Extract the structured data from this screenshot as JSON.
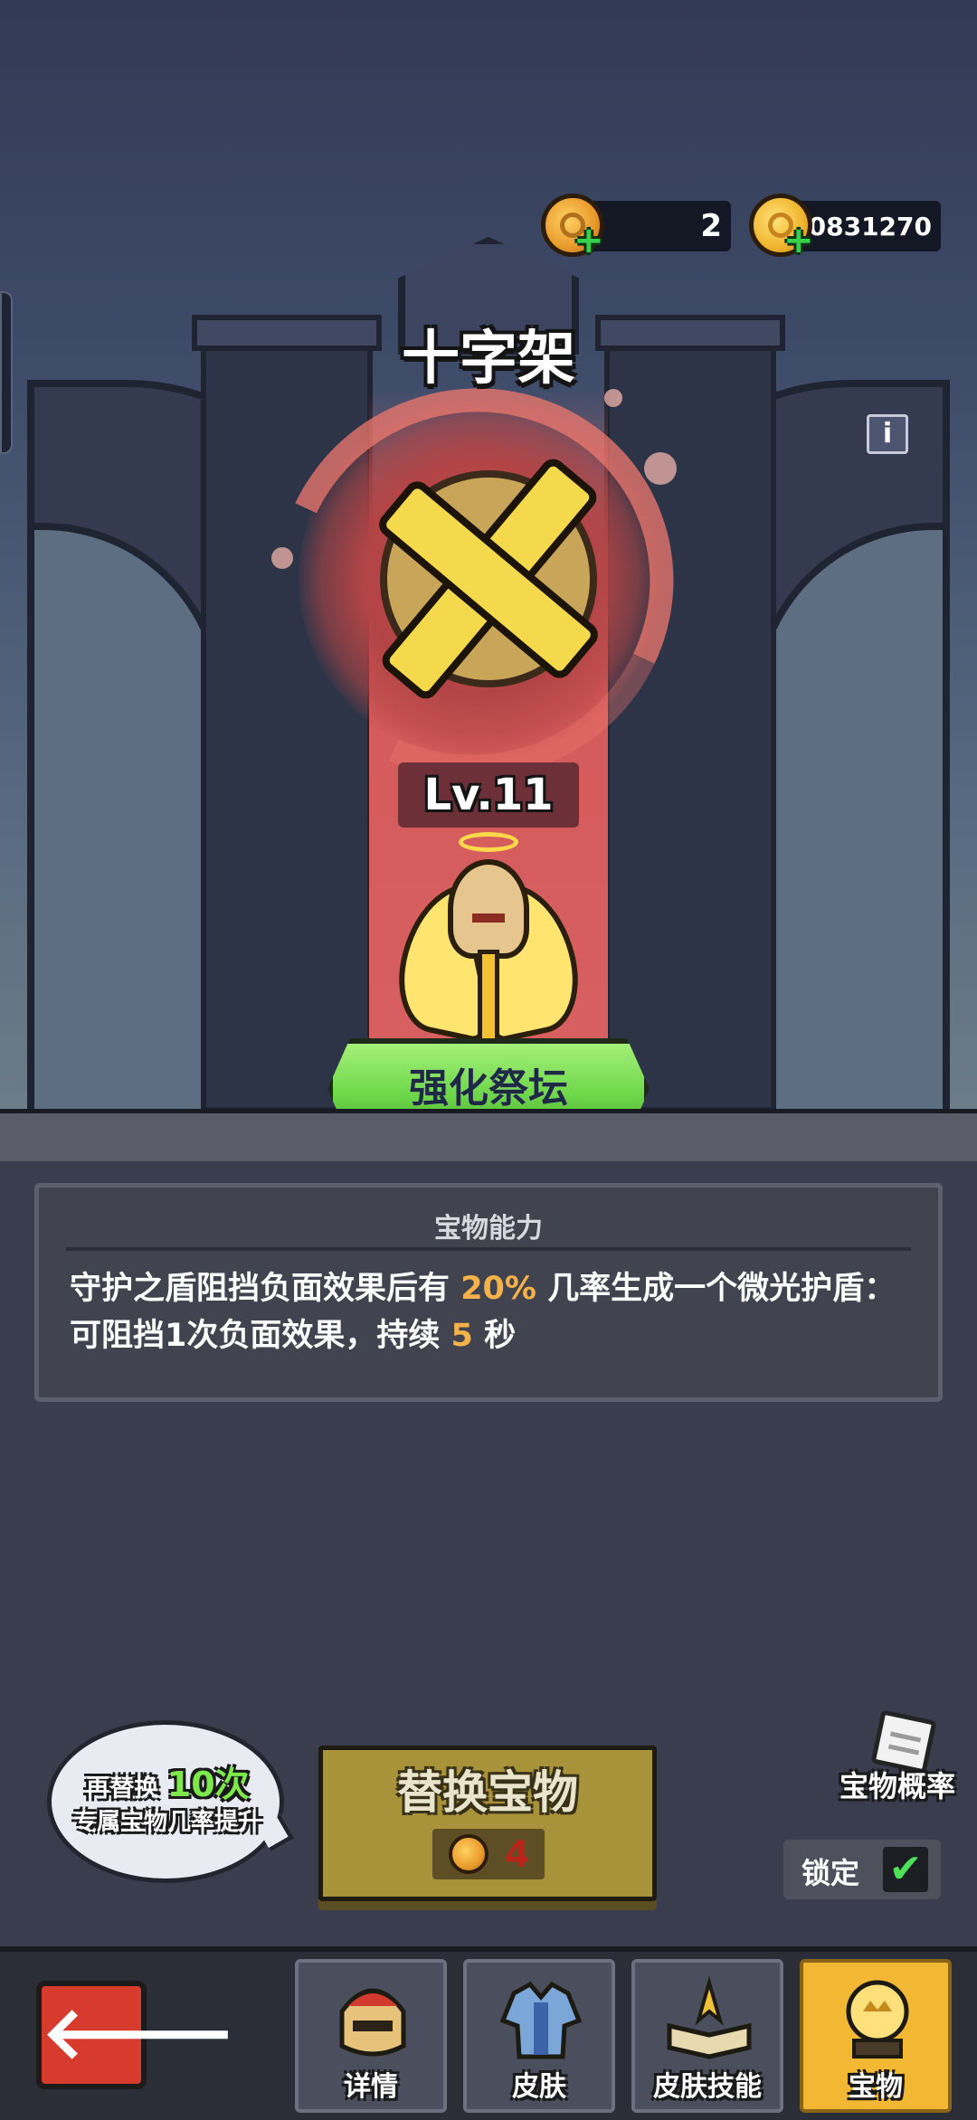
{
  "currencies": {
    "gem": {
      "amount": "2",
      "icon": "gem-coin-icon"
    },
    "gold": {
      "amount": "40831270",
      "icon": "gold-coin-icon"
    }
  },
  "treasure": {
    "name": "十字架",
    "level": "Lv.11"
  },
  "info_icon": "i",
  "altar_button": "强化祭坛",
  "ability": {
    "title": "宝物能力",
    "text_part1": "守护之盾阻挡负面效果后有 ",
    "chance": "20%",
    "text_part2": " 几率生成一个微光护盾：可阻挡1次负面效果，持续 ",
    "duration": "5",
    "text_part3": " 秒"
  },
  "hint_bubble": {
    "prefix": "再替换 ",
    "count": "10次",
    "line2": "专属宝物几率提升"
  },
  "replace_button": {
    "label": "替换宝物",
    "cost": "4"
  },
  "probability_label": "宝物概率",
  "lock": {
    "label": "锁定",
    "checked": "✔"
  },
  "nav": {
    "back": "🡐",
    "tabs": [
      {
        "label": "详情",
        "active": false
      },
      {
        "label": "皮肤",
        "active": false
      },
      {
        "label": "皮肤技能",
        "active": false
      },
      {
        "label": "宝物",
        "active": true
      }
    ]
  },
  "colors": {
    "highlight": "#f5b24a",
    "accent_green": "#7ce84a",
    "cost_red": "#b8241a",
    "active_tab": "#f2b834"
  }
}
